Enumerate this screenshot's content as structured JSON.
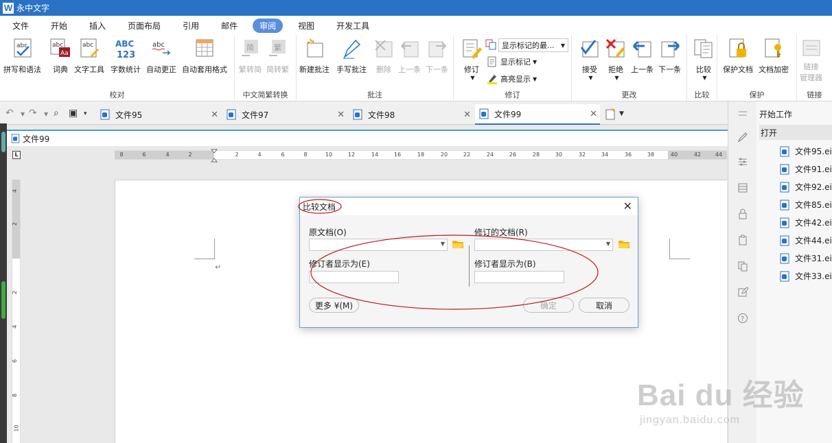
{
  "app": {
    "title": "永中文字",
    "logo": "W"
  },
  "menu": [
    "文件",
    "开始",
    "插入",
    "页面布局",
    "引用",
    "邮件",
    "审阅",
    "视图",
    "开发工具"
  ],
  "ribbon": {
    "proof": {
      "label": "校对",
      "spell": "拼写和语法",
      "dict": "词典",
      "texttools": "文字工具",
      "wordcount": "字数统计",
      "autocorrect": "自动更正",
      "autoformat": "自动套用格式"
    },
    "chinese": {
      "label": "中文简繁转换",
      "t2s": "繁转简",
      "s2t": "简转繁",
      "jian": "简",
      "fan": "繁"
    },
    "comments": {
      "label": "批注",
      "new": "新建批注",
      "hand": "手写批注",
      "delete": "删除",
      "prev": "上一条",
      "next": "下一条"
    },
    "revise": {
      "label": "修订",
      "track": "修订",
      "markup_select": "显示标记的最...",
      "show_markup": "显示标记",
      "highlight": "高亮显示"
    },
    "changes": {
      "label": "更改",
      "accept": "接受",
      "reject": "拒绝",
      "prev": "上一条",
      "next": "下一条"
    },
    "compare": {
      "label": "比较",
      "compare": "比较"
    },
    "protect": {
      "label": "保护",
      "protect_doc": "保护文档",
      "encrypt": "文档加密"
    },
    "link": {
      "label": "链接",
      "manager_line1": "链接",
      "manager_line2": "管理器"
    }
  },
  "tabs": [
    {
      "name": "文件95"
    },
    {
      "name": "文件97"
    },
    {
      "name": "文件98"
    },
    {
      "name": "文件99"
    }
  ],
  "doc": {
    "title": "文件99",
    "ruler_corner": "L"
  },
  "ruler": {
    "h": [
      "8",
      "6",
      "4",
      "2",
      "2",
      "4",
      "6",
      "8",
      "10",
      "12",
      "14",
      "16",
      "18",
      "20",
      "22",
      "24",
      "26",
      "28",
      "30",
      "32",
      "34",
      "36",
      "38",
      "40",
      "42",
      "44"
    ],
    "v": [
      "4",
      "2",
      "2",
      "4",
      "6",
      "8",
      "10"
    ]
  },
  "dialog": {
    "title": "比较文档",
    "original_label": "原文档(O)",
    "revised_label": "修订的文档(R)",
    "author_label_left": "修订者显示为(E)",
    "author_label_right": "修订者显示为(B)",
    "more": "更多 ¥(M)",
    "ok": "确定",
    "cancel": "取消",
    "close": "✕"
  },
  "rpanel": {
    "header": "开始工作",
    "open": "打开",
    "files": [
      "文件95.eio",
      "文件91.eio",
      "文件92.eio",
      "文件85.eio",
      "文件42.eio",
      "文件44.eio",
      "文件31.eio",
      "文件33.eio"
    ]
  },
  "watermark": {
    "line1": "Bai du 经验",
    "line2": "jingyan.baidu.com"
  },
  "colors": {
    "titlebar": "#2a73c4",
    "accent": "#5a8fdb",
    "ellipse": "#c0151c"
  }
}
